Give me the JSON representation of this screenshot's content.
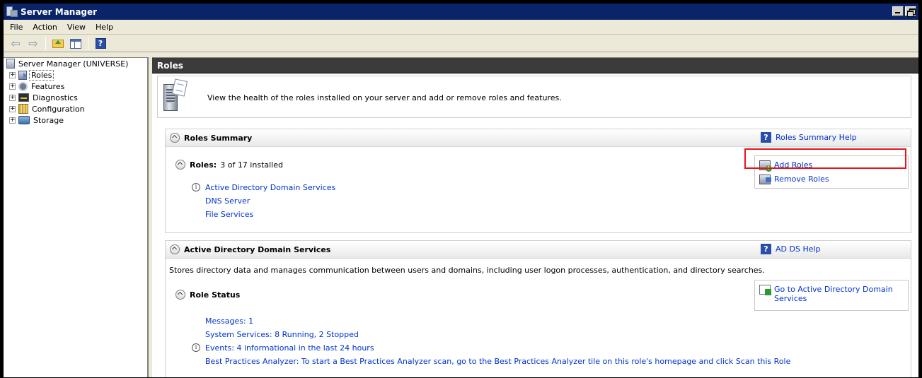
{
  "window": {
    "title": "Server Manager"
  },
  "menu": [
    "File",
    "Action",
    "View",
    "Help"
  ],
  "toolbar": {
    "help_glyph": "?"
  },
  "tree": {
    "root_label": "Server Manager (UNIVERSE)",
    "expander_glyph": "+",
    "items": [
      {
        "label": "Roles",
        "icon": "roles-icon",
        "selected": true
      },
      {
        "label": "Features",
        "icon": "features-icon"
      },
      {
        "label": "Diagnostics",
        "icon": "diagnostics-icon"
      },
      {
        "label": "Configuration",
        "icon": "configuration-icon"
      },
      {
        "label": "Storage",
        "icon": "storage-icon"
      }
    ]
  },
  "content": {
    "header": "Roles",
    "intro_text": "View the health of the roles installed on your server and add or remove roles and features.",
    "roles_summary": {
      "title": "Roles Summary",
      "help_label": "Roles Summary Help",
      "roles_label": "Roles:",
      "roles_count": "3 of 17 installed",
      "installed_roles": [
        "Active Directory Domain Services",
        "DNS Server",
        "File Services"
      ],
      "tasks": {
        "add_roles": "Add Roles",
        "remove_roles": "Remove Roles"
      }
    },
    "ad_ds": {
      "title": "Active Directory Domain Services",
      "help_label": "AD DS Help",
      "description": "Stores directory data and manages communication between users and domains, including user logon processes, authentication, and directory searches.",
      "role_status_title": "Role Status",
      "goto_label": "Go to Active Directory Domain Services",
      "status_links": {
        "messages": "Messages: 1",
        "services": "System Services: 8 Running, 2 Stopped",
        "events": "Events: 4 informational in the last 24 hours",
        "bpa": "Best Practices Analyzer: To start a Best Practices Analyzer scan, go to the Best Practices Analyzer tile on this role's homepage and click Scan this Role"
      }
    }
  },
  "colors": {
    "titlebar": "#0a246a",
    "link": "#0033cc",
    "highlight": "#e8141a",
    "header_bar": "#3b3b3b"
  },
  "glyphs": {
    "info": "i",
    "help": "?"
  }
}
